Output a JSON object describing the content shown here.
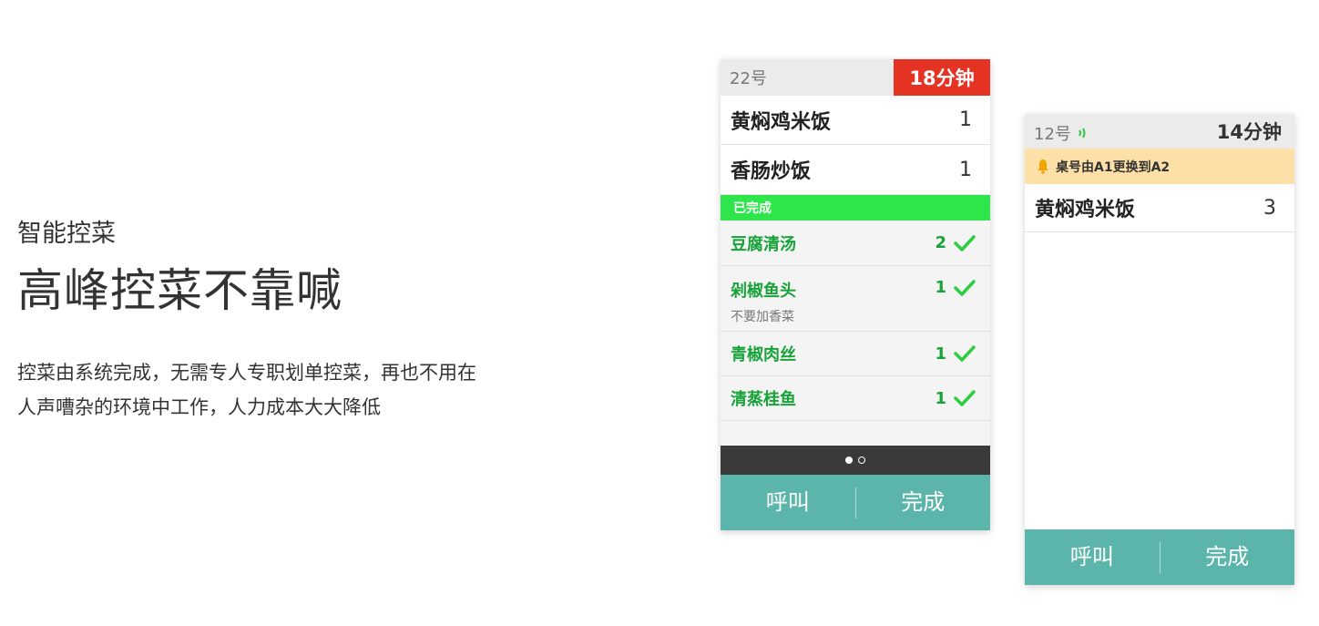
{
  "hero": {
    "eyebrow": "智能控菜",
    "headline": "高峰控菜不靠喊",
    "desc_line1": "控菜由系统完成，无需专人专职划单控菜，再也不用在",
    "desc_line2": "人声嘈杂的环境中工作，人力成本大大降低"
  },
  "device1": {
    "order_num": "22号",
    "timer": "18分钟",
    "timer_color": "#e53323",
    "items": [
      {
        "name": "黄焖鸡米饭",
        "qty": "1"
      },
      {
        "name": "香肠炒饭",
        "qty": "1"
      }
    ],
    "done_label": "已完成",
    "done_items": [
      {
        "name": "豆腐清汤",
        "qty": "2",
        "note": ""
      },
      {
        "name": "剁椒鱼头",
        "qty": "1",
        "note": "不要加香菜"
      },
      {
        "name": "青椒肉丝",
        "qty": "1",
        "note": ""
      },
      {
        "name": "清蒸桂鱼",
        "qty": "1",
        "note": ""
      }
    ],
    "pager": {
      "current": 1,
      "total": 2
    },
    "actions": {
      "call": "呼叫",
      "complete": "完成"
    }
  },
  "device2": {
    "order_num": "12号",
    "order_icon": "sound-wave-icon",
    "timer": "14分钟",
    "notice": "桌号由A1更换到A2",
    "notice_icon": "bell-icon",
    "items": [
      {
        "name": "黄焖鸡米饭",
        "qty": "3"
      }
    ],
    "actions": {
      "call": "呼叫",
      "complete": "完成"
    }
  },
  "colors": {
    "done_green": "#2ee54c",
    "done_text": "#18a23a",
    "action_teal": "#5bb5aa",
    "notice_bg": "#fde0a8"
  }
}
